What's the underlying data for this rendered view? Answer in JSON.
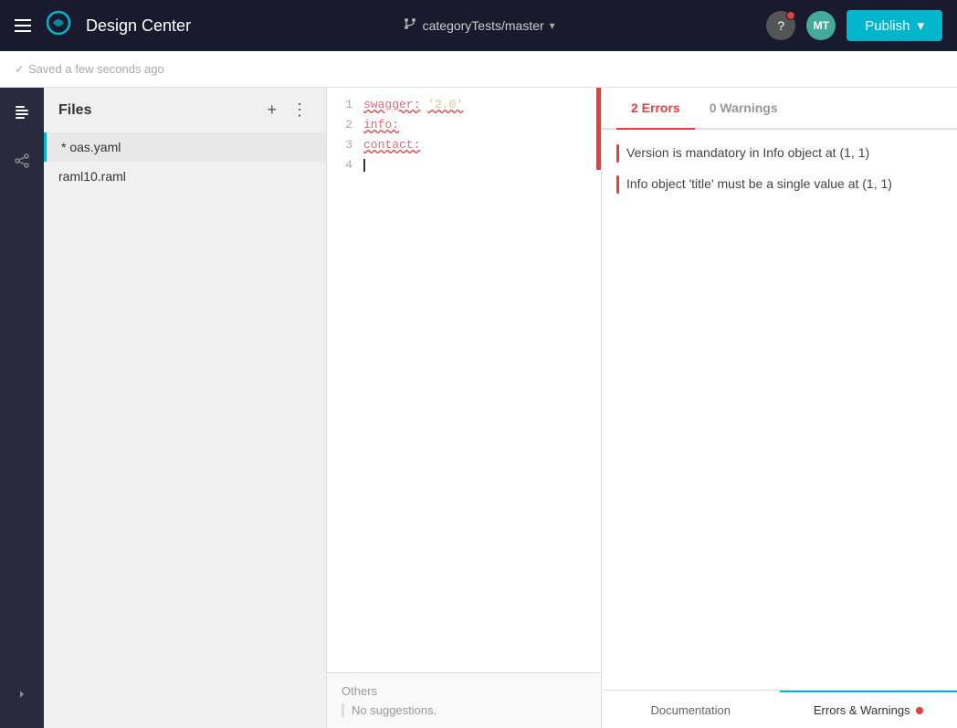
{
  "navbar": {
    "title": "Design Center",
    "branch": "categoryTests/master",
    "publish_label": "Publish",
    "avatar_text": "MT",
    "help_label": "?"
  },
  "subheader": {
    "saved_status": "Saved a few seconds ago"
  },
  "files_panel": {
    "title": "Files",
    "add_label": "+",
    "more_label": "⋮",
    "items": [
      {
        "name": "* oas.yaml",
        "active": true
      },
      {
        "name": "raml10.raml",
        "active": false
      }
    ]
  },
  "editor": {
    "lines": [
      {
        "num": "1",
        "content_raw": "swagger: '2.0'"
      },
      {
        "num": "2",
        "content_raw": "info:"
      },
      {
        "num": "3",
        "content_raw": "  contact:"
      },
      {
        "num": "4",
        "content_raw": ""
      }
    ]
  },
  "suggestions": {
    "title": "Others",
    "no_suggestions": "No suggestions."
  },
  "right_panel": {
    "tabs": [
      {
        "label": "2 Errors",
        "active": true
      },
      {
        "label": "0 Warnings",
        "active": false
      }
    ],
    "errors": [
      {
        "text": "Version is mandatory in Info object at (1, 1)"
      },
      {
        "text": "Info object 'title' must be a single value at (1, 1)"
      }
    ]
  },
  "bottom_tabs": [
    {
      "label": "Documentation",
      "active": false
    },
    {
      "label": "Errors & Warnings",
      "active": true,
      "has_dot": true
    }
  ]
}
